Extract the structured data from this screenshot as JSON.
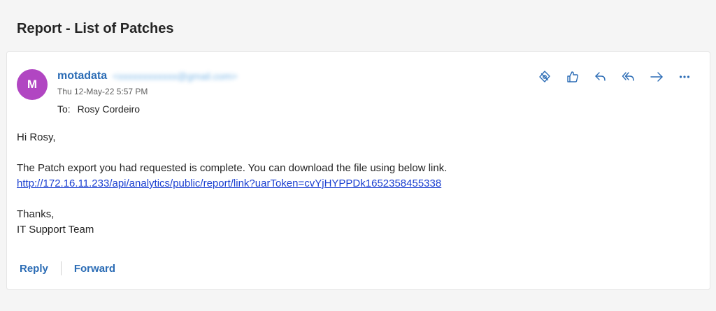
{
  "header": {
    "subject": "Report - List of Patches"
  },
  "message": {
    "avatar_initial": "M",
    "sender_name": "motadata",
    "sender_email": "<xxxxxxxxxxxx@gmail.com>",
    "date": "Thu 12-May-22 5:57 PM",
    "to_label": "To:",
    "to_name": "Rosy Cordeiro",
    "greeting": "Hi Rosy,",
    "body_line": "The Patch export you had requested is complete. You can download the file using below link.",
    "link": "http://172.16.11.233/api/analytics/public/report/link?uarToken=cvYjHYPPDk1652358455338",
    "closing": "Thanks,",
    "signature": "IT Support Team"
  },
  "actions": {
    "icons": [
      "tag-icon",
      "like-icon",
      "reply-icon",
      "reply-all-icon",
      "forward-icon",
      "more-icon"
    ]
  },
  "footer": {
    "reply_label": "Reply",
    "forward_label": "Forward"
  },
  "colors": {
    "accent": "#2b6cb5",
    "avatar": "#b146c2",
    "link": "#1a3fd1"
  }
}
